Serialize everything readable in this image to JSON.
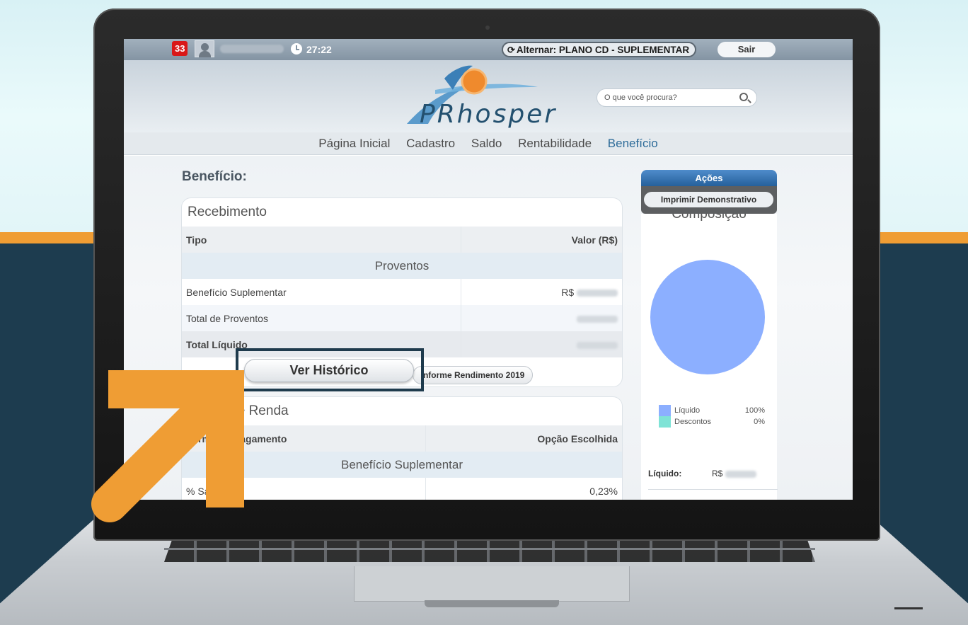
{
  "topbar": {
    "notification_count": "33",
    "timer": "27:22",
    "switch_label": "Alternar: PLANO CD - SUPLEMENTAR",
    "logout_label": "Sair"
  },
  "header": {
    "logo_text": "PRhosper",
    "search_placeholder": "O que você procura?"
  },
  "nav": {
    "items": [
      "Página Inicial",
      "Cadastro",
      "Saldo",
      "Rentabilidade",
      "Benefício"
    ],
    "active": "Benefício"
  },
  "main": {
    "title": "Benefício:",
    "recebimento": {
      "title": "Recebimento",
      "col_tipo": "Tipo",
      "col_valor": "Valor (R$)",
      "section": "Proventos",
      "rows": [
        {
          "tipo": "Benefício Suplementar",
          "valor_prefix": "R$"
        },
        {
          "tipo": "Total de Proventos",
          "valor_prefix": ""
        }
      ],
      "total_label": "Total Líquido",
      "historico_button": "Ver Histórico",
      "informe_button": "Informe Rendimento 2019"
    },
    "renda": {
      "title": "Forma de Renda",
      "col_forma": "Forma de Pagamento",
      "col_opcao": "Opção Escolhida",
      "section": "Benefício Suplementar",
      "rows": [
        {
          "forma": "% Saldo Fixo",
          "opcao": "0,23%"
        }
      ]
    }
  },
  "sidebar": {
    "acoes_title": "Ações",
    "imprimir_button": "Imprimir Demonstrativo",
    "composicao_title": "Composição",
    "legend": [
      {
        "label": "Líquido",
        "pct": "100%",
        "color": "#8cafff"
      },
      {
        "label": "Descontos",
        "pct": "0%",
        "color": "#7fe3d6"
      }
    ],
    "liquido_label": "Líquido:",
    "liquido_prefix": "R$"
  },
  "colors": {
    "accent_orange": "#ef9d34",
    "dark_bg": "#1d3c4f",
    "nav_active": "#2d6b99",
    "acoes_blue": "#25609b",
    "pie_liquido": "#8cafff",
    "pie_descontos": "#7fe3d6"
  }
}
